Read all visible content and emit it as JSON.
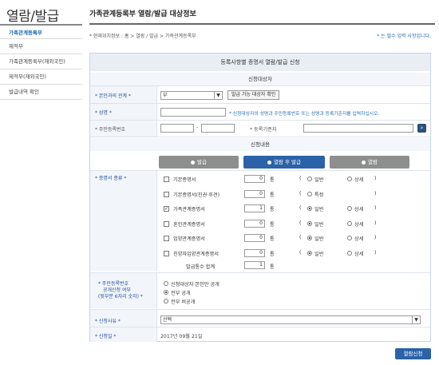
{
  "sidebar": {
    "title": "열람/발급",
    "items": [
      {
        "label": "가족관계등록부"
      },
      {
        "label": "제적부"
      },
      {
        "label": "가족관계등록부(재외국민)"
      },
      {
        "label": "제적부(재외국민)"
      },
      {
        "label": "발급내역 확인"
      }
    ]
  },
  "header": {
    "title": "가족관계등록부 열람/발급 대상정보",
    "breadcrumb": "* 현재위치정보 : 홈 > 열람 / 발급 > 가족관계등록부",
    "required_note": "* 는 필수 입력 사항입니다."
  },
  "form": {
    "title": "등록사항별 증명서 열람/발급 신청",
    "section_target": "신청대상자",
    "section_content": "신청내용",
    "relation": {
      "label": "* 본인과의 관계 *",
      "value": "부",
      "check_button": "발급 가능 대상자 확인"
    },
    "name": {
      "label": "* 성명 *",
      "value": "",
      "hint": "* 신청대상자의 성명과 주민등록번호 또는 성명과 등록기준지를 입력하십시오."
    },
    "rrn": {
      "label": "* 주민등록번호",
      "part1": "",
      "dash": "-",
      "part2": ""
    },
    "base_place": {
      "label": "* 등록기준지",
      "value": ""
    },
    "tabs": [
      {
        "label": "발급",
        "active": false
      },
      {
        "label": "열람 후 발급",
        "active": true
      },
      {
        "label": "열람",
        "active": false
      }
    ],
    "cert_label": "* 증명서 종류 *",
    "certs": [
      {
        "name": "기본증명서",
        "checked": false,
        "count": "0",
        "unit": "통",
        "open": "(",
        "opt1": "일반",
        "opt1_on": false,
        "opt2": "상세",
        "opt2_on": false,
        "close": ")"
      },
      {
        "name": "기본증명서(친권·후견)",
        "checked": false,
        "count": "0",
        "unit": "통",
        "open": "(",
        "opt1": "특정",
        "opt1_on": false,
        "opt2": "",
        "opt2_on": false,
        "close": ")"
      },
      {
        "name": "가족관계증명서",
        "checked": true,
        "count": "1",
        "unit": "통",
        "open": "(",
        "opt1": "일반",
        "opt1_on": true,
        "opt2": "상세",
        "opt2_on": false,
        "close": ")"
      },
      {
        "name": "혼인관계증명서",
        "checked": false,
        "count": "0",
        "unit": "통",
        "open": "(",
        "opt1": "일반",
        "opt1_on": true,
        "opt2": "상세",
        "opt2_on": false,
        "close": ")"
      },
      {
        "name": "입양관계증명서",
        "checked": false,
        "count": "0",
        "unit": "통",
        "open": "(",
        "opt1": "일반",
        "opt1_on": true,
        "opt2": "상세",
        "opt2_on": false,
        "close": ")"
      },
      {
        "name": "친양자입양관계증명서",
        "checked": false,
        "count": "0",
        "unit": "통",
        "open": "(",
        "opt1": "일반",
        "opt1_on": true,
        "opt2": "상세",
        "opt2_on": false,
        "close": ")"
      }
    ],
    "total": {
      "label": "발급통수 합계",
      "count": "1",
      "unit": "통"
    },
    "disclosure": {
      "label1": "* 주민등록번호",
      "label2": "공개신청 여부",
      "label3": "(뒷부분 6자리 숫자) *",
      "options": [
        {
          "label": "신청대상자 본인만 공개",
          "on": false
        },
        {
          "label": "전부 공개",
          "on": true
        },
        {
          "label": "전부 비공개",
          "on": false
        }
      ]
    },
    "reason": {
      "label": "* 신청사유 *",
      "value": "선택"
    },
    "date": {
      "label": "* 신청일 *",
      "value": "2017년 09월 21일"
    },
    "submit": "열람신청"
  }
}
